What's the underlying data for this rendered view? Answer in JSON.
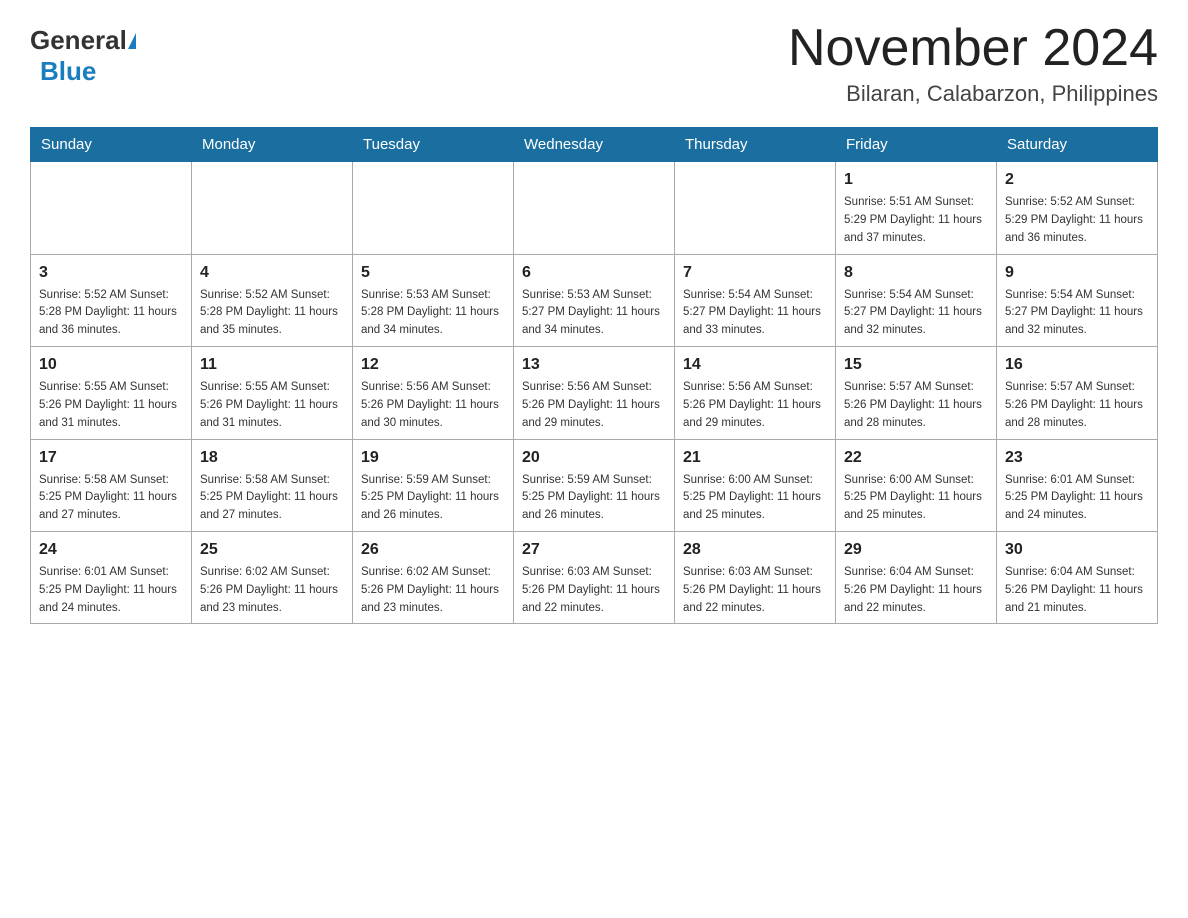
{
  "header": {
    "logo_general": "General",
    "logo_blue": "Blue",
    "month_title": "November 2024",
    "location": "Bilaran, Calabarzon, Philippines"
  },
  "weekdays": [
    "Sunday",
    "Monday",
    "Tuesday",
    "Wednesday",
    "Thursday",
    "Friday",
    "Saturday"
  ],
  "rows": [
    [
      {
        "day": "",
        "info": ""
      },
      {
        "day": "",
        "info": ""
      },
      {
        "day": "",
        "info": ""
      },
      {
        "day": "",
        "info": ""
      },
      {
        "day": "",
        "info": ""
      },
      {
        "day": "1",
        "info": "Sunrise: 5:51 AM\nSunset: 5:29 PM\nDaylight: 11 hours\nand 37 minutes."
      },
      {
        "day": "2",
        "info": "Sunrise: 5:52 AM\nSunset: 5:29 PM\nDaylight: 11 hours\nand 36 minutes."
      }
    ],
    [
      {
        "day": "3",
        "info": "Sunrise: 5:52 AM\nSunset: 5:28 PM\nDaylight: 11 hours\nand 36 minutes."
      },
      {
        "day": "4",
        "info": "Sunrise: 5:52 AM\nSunset: 5:28 PM\nDaylight: 11 hours\nand 35 minutes."
      },
      {
        "day": "5",
        "info": "Sunrise: 5:53 AM\nSunset: 5:28 PM\nDaylight: 11 hours\nand 34 minutes."
      },
      {
        "day": "6",
        "info": "Sunrise: 5:53 AM\nSunset: 5:27 PM\nDaylight: 11 hours\nand 34 minutes."
      },
      {
        "day": "7",
        "info": "Sunrise: 5:54 AM\nSunset: 5:27 PM\nDaylight: 11 hours\nand 33 minutes."
      },
      {
        "day": "8",
        "info": "Sunrise: 5:54 AM\nSunset: 5:27 PM\nDaylight: 11 hours\nand 32 minutes."
      },
      {
        "day": "9",
        "info": "Sunrise: 5:54 AM\nSunset: 5:27 PM\nDaylight: 11 hours\nand 32 minutes."
      }
    ],
    [
      {
        "day": "10",
        "info": "Sunrise: 5:55 AM\nSunset: 5:26 PM\nDaylight: 11 hours\nand 31 minutes."
      },
      {
        "day": "11",
        "info": "Sunrise: 5:55 AM\nSunset: 5:26 PM\nDaylight: 11 hours\nand 31 minutes."
      },
      {
        "day": "12",
        "info": "Sunrise: 5:56 AM\nSunset: 5:26 PM\nDaylight: 11 hours\nand 30 minutes."
      },
      {
        "day": "13",
        "info": "Sunrise: 5:56 AM\nSunset: 5:26 PM\nDaylight: 11 hours\nand 29 minutes."
      },
      {
        "day": "14",
        "info": "Sunrise: 5:56 AM\nSunset: 5:26 PM\nDaylight: 11 hours\nand 29 minutes."
      },
      {
        "day": "15",
        "info": "Sunrise: 5:57 AM\nSunset: 5:26 PM\nDaylight: 11 hours\nand 28 minutes."
      },
      {
        "day": "16",
        "info": "Sunrise: 5:57 AM\nSunset: 5:26 PM\nDaylight: 11 hours\nand 28 minutes."
      }
    ],
    [
      {
        "day": "17",
        "info": "Sunrise: 5:58 AM\nSunset: 5:25 PM\nDaylight: 11 hours\nand 27 minutes."
      },
      {
        "day": "18",
        "info": "Sunrise: 5:58 AM\nSunset: 5:25 PM\nDaylight: 11 hours\nand 27 minutes."
      },
      {
        "day": "19",
        "info": "Sunrise: 5:59 AM\nSunset: 5:25 PM\nDaylight: 11 hours\nand 26 minutes."
      },
      {
        "day": "20",
        "info": "Sunrise: 5:59 AM\nSunset: 5:25 PM\nDaylight: 11 hours\nand 26 minutes."
      },
      {
        "day": "21",
        "info": "Sunrise: 6:00 AM\nSunset: 5:25 PM\nDaylight: 11 hours\nand 25 minutes."
      },
      {
        "day": "22",
        "info": "Sunrise: 6:00 AM\nSunset: 5:25 PM\nDaylight: 11 hours\nand 25 minutes."
      },
      {
        "day": "23",
        "info": "Sunrise: 6:01 AM\nSunset: 5:25 PM\nDaylight: 11 hours\nand 24 minutes."
      }
    ],
    [
      {
        "day": "24",
        "info": "Sunrise: 6:01 AM\nSunset: 5:25 PM\nDaylight: 11 hours\nand 24 minutes."
      },
      {
        "day": "25",
        "info": "Sunrise: 6:02 AM\nSunset: 5:26 PM\nDaylight: 11 hours\nand 23 minutes."
      },
      {
        "day": "26",
        "info": "Sunrise: 6:02 AM\nSunset: 5:26 PM\nDaylight: 11 hours\nand 23 minutes."
      },
      {
        "day": "27",
        "info": "Sunrise: 6:03 AM\nSunset: 5:26 PM\nDaylight: 11 hours\nand 22 minutes."
      },
      {
        "day": "28",
        "info": "Sunrise: 6:03 AM\nSunset: 5:26 PM\nDaylight: 11 hours\nand 22 minutes."
      },
      {
        "day": "29",
        "info": "Sunrise: 6:04 AM\nSunset: 5:26 PM\nDaylight: 11 hours\nand 22 minutes."
      },
      {
        "day": "30",
        "info": "Sunrise: 6:04 AM\nSunset: 5:26 PM\nDaylight: 11 hours\nand 21 minutes."
      }
    ]
  ]
}
